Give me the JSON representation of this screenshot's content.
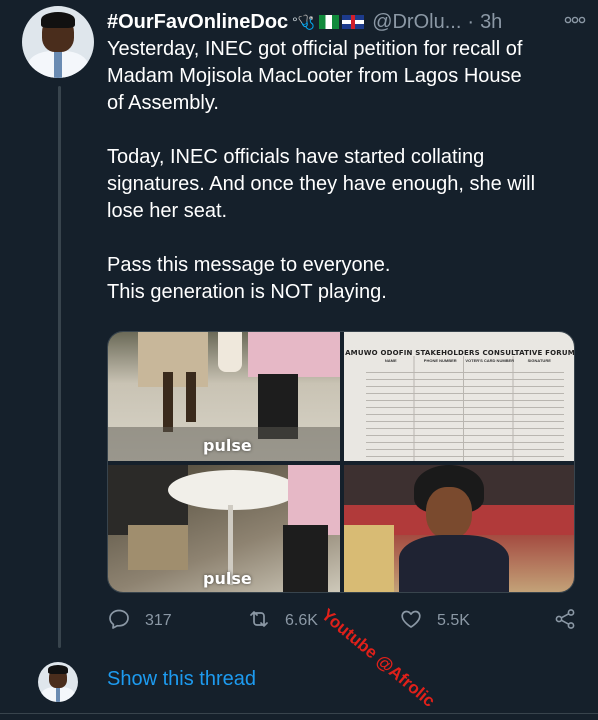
{
  "tweet": {
    "display_name": "#OurFavOnlineDoc",
    "name_emoji": "°🩺",
    "handle": "@DrOlu...",
    "separator": "·",
    "time": "3h",
    "more_icon": "more-options-icon",
    "paragraphs": [
      [
        "Yesterday, INEC got official petition for recall of",
        "Madam Mojisola MacLooter from Lagos House",
        "of Assembly."
      ],
      [
        "Today, INEC officials have started collating",
        "signatures. And once they have enough, she will",
        "lose her seat."
      ],
      [
        "Pass this message to everyone.",
        "This generation is NOT playing."
      ]
    ],
    "media": {
      "watermark_text": "pulse",
      "form_title": "AMUWO ODOFIN STAKEHOLDERS CONSULTATIVE FORUM",
      "form_columns": [
        "NAME",
        "PHONE NUMBER",
        "VOTER'S CARD NUMBER",
        "SIGNATURE"
      ]
    },
    "actions": {
      "reply_count": "317",
      "retweet_count": "6.6K",
      "like_count": "5.5K"
    }
  },
  "overlay_watermark": "Youtube @Afrolic",
  "thread": {
    "show_label": "Show this thread"
  },
  "colors": {
    "background": "#15202b",
    "text": "#ffffff",
    "muted": "#8b98a5",
    "link": "#1d9bf0",
    "watermark": "#e0201a"
  }
}
